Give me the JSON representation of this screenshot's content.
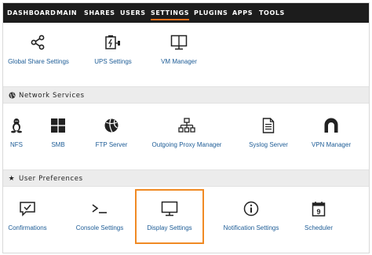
{
  "nav": {
    "items": [
      "DASHBOARD",
      "MAIN",
      "SHARES",
      "USERS",
      "SETTINGS",
      "PLUGINS",
      "APPS",
      "TOOLS"
    ],
    "active": "SETTINGS",
    "accent": "#e46e19"
  },
  "system": {
    "tiles": [
      {
        "label": "Global Share Settings",
        "icon": "share-icon"
      },
      {
        "label": "UPS Settings",
        "icon": "battery-plug-icon"
      },
      {
        "label": "VM Manager",
        "icon": "vm-monitor-icon"
      }
    ]
  },
  "network": {
    "title": "Network Services",
    "icon": "globe-icon",
    "tiles": [
      {
        "label": "NFS",
        "icon": "linux-penguin-icon"
      },
      {
        "label": "SMB",
        "icon": "windows-icon"
      },
      {
        "label": "FTP Server",
        "icon": "ftp-ball-icon"
      },
      {
        "label": "Outgoing Proxy Manager",
        "icon": "network-tree-icon"
      },
      {
        "label": "Syslog Server",
        "icon": "document-icon"
      },
      {
        "label": "VPN Manager",
        "icon": "vpn-arch-icon"
      }
    ]
  },
  "preferences": {
    "title": "User Preferences",
    "icon": "star-icon",
    "tiles": [
      {
        "label": "Confirmations",
        "icon": "message-check-icon"
      },
      {
        "label": "Console Settings",
        "icon": "terminal-icon"
      },
      {
        "label": "Display Settings",
        "icon": "monitor-icon"
      },
      {
        "label": "Notification Settings",
        "icon": "info-icon"
      },
      {
        "label": "Scheduler",
        "icon": "calendar-icon"
      }
    ],
    "highlighted": "Display Settings",
    "highlight_color": "#f08a24"
  },
  "colors": {
    "link": "#1d5c96",
    "nav_bg": "#1c1c1c",
    "section_bg": "#ececec"
  }
}
